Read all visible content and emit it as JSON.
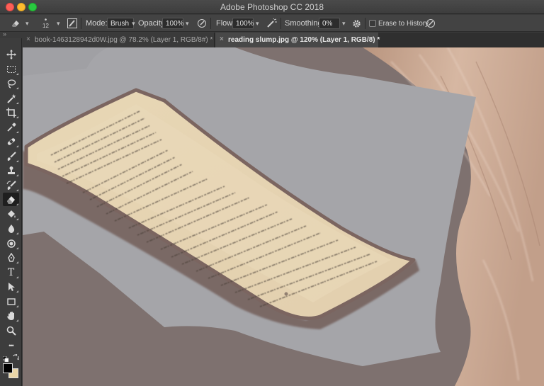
{
  "window": {
    "title": "Adobe Photoshop CC 2018"
  },
  "options_bar": {
    "brush_size": "12",
    "mode_label": "Mode:",
    "mode_value": "Brush",
    "opacity_label": "Opacity:",
    "opacity_value": "100%",
    "flow_label": "Flow:",
    "flow_value": "100%",
    "smoothing_label": "Smoothing:",
    "smoothing_value": "0%",
    "erase_history_label": "Erase to History"
  },
  "tabs": [
    {
      "label": "book-1463128942d0W.jpg @ 78.2% (Layer 1, RGB/8#) *",
      "close": "×"
    },
    {
      "label": "reading slump.jpg @ 120% (Layer 1, RGB/8) *",
      "close": "×"
    }
  ],
  "panel_collapse_glyph": "»",
  "toolbar": {
    "tools": [
      "move-tool",
      "marquee-tool",
      "lasso-tool",
      "magic-wand-tool",
      "crop-tool",
      "eyedropper-tool",
      "healing-brush-tool",
      "brush-tool",
      "clone-stamp-tool",
      "history-brush-tool",
      "eraser-tool",
      "paint-bucket-tool",
      "blur-tool",
      "dodge-tool",
      "pen-tool",
      "type-tool",
      "path-selection-tool",
      "rectangle-tool",
      "hand-tool",
      "zoom-tool",
      "more-tools"
    ],
    "active_tool": "eraser-tool",
    "type_tool_glyph": "T",
    "more_tools_glyph": "•••",
    "foreground_color": "#000000",
    "background_color": "#e9d6a7"
  },
  "colors": {
    "canvas_gray": "#a3a3a7",
    "paper": "#e3d2b2",
    "sweater": "#c9a790"
  }
}
